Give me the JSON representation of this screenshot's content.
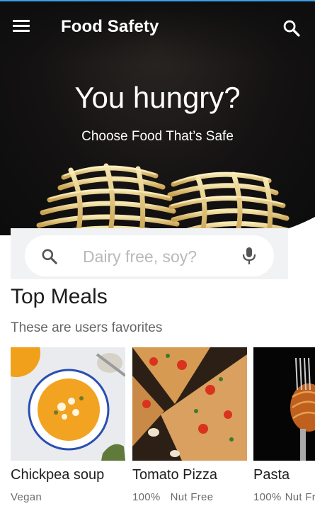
{
  "app": {
    "title": "Food Safety"
  },
  "hero": {
    "headline": "You hungry?",
    "subheadline": "Choose Food That’s Safe"
  },
  "search": {
    "placeholder": "Dairy free, soy?"
  },
  "top_meals": {
    "title": "Top Meals",
    "subtitle": "These are users favorites",
    "meals": [
      {
        "name": "Chickpea soup",
        "tags": [
          "Vegan"
        ]
      },
      {
        "name": "Tomato Pizza",
        "tags": [
          "100%",
          "Nut Free"
        ]
      },
      {
        "name": "Pasta",
        "tags": [
          "100%",
          "Nut Free"
        ]
      }
    ]
  },
  "icons": {
    "menu": "menu-icon",
    "search": "search-icon",
    "mic": "mic-icon"
  },
  "colors": {
    "accent_line": "#3aa0e6",
    "hero_bg": "#121212",
    "search_bg": "#f1f2f4"
  }
}
